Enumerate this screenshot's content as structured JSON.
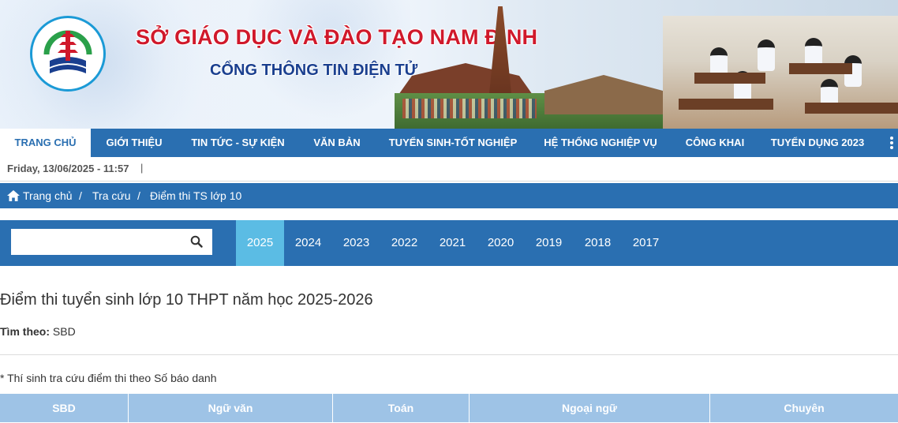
{
  "header": {
    "title": "SỞ GIÁO DỤC VÀ ĐÀO TẠO NAM ĐỊNH",
    "subtitle": "CỔNG THÔNG TIN ĐIỆN TỬ"
  },
  "nav": {
    "items": [
      {
        "label": "TRANG CHỦ",
        "active": true
      },
      {
        "label": "GIỚI THIỆU"
      },
      {
        "label": "TIN TỨC - SỰ KIỆN"
      },
      {
        "label": "VĂN BẢN"
      },
      {
        "label": "TUYỂN SINH-TỐT NGHIỆP"
      },
      {
        "label": "HỆ THỐNG NGHIỆP VỤ"
      },
      {
        "label": "CÔNG KHAI"
      },
      {
        "label": "TUYỂN DỤNG 2023"
      }
    ]
  },
  "datebar": {
    "date": "Friday, 13/06/2025 - 11:57",
    "separator": "|"
  },
  "breadcrumb": {
    "home": "Trang chủ",
    "sep1": "/",
    "level2": "Tra cứu",
    "sep2": "/",
    "current": "Điểm thi TS lớp 10"
  },
  "search": {
    "value": "",
    "placeholder": ""
  },
  "years": [
    "2025",
    "2024",
    "2023",
    "2022",
    "2021",
    "2020",
    "2019",
    "2018",
    "2017"
  ],
  "active_year": "2025",
  "content": {
    "title": "Điểm thi tuyển sinh lớp 10 THPT năm học 2025-2026",
    "search_by_label": "Tìm theo:",
    "search_by_value": "SBD",
    "note": "* Thí sinh tra cứu điểm thi theo Số báo danh"
  },
  "table": {
    "headers": [
      "SBD",
      "Ngữ văn",
      "Toán",
      "Ngoại ngữ",
      "Chuyên"
    ]
  },
  "colors": {
    "primary": "#2a6fb1",
    "active_tab": "#5bbce4",
    "table_header": "#9ec3e6",
    "title_red": "#d0192b"
  }
}
